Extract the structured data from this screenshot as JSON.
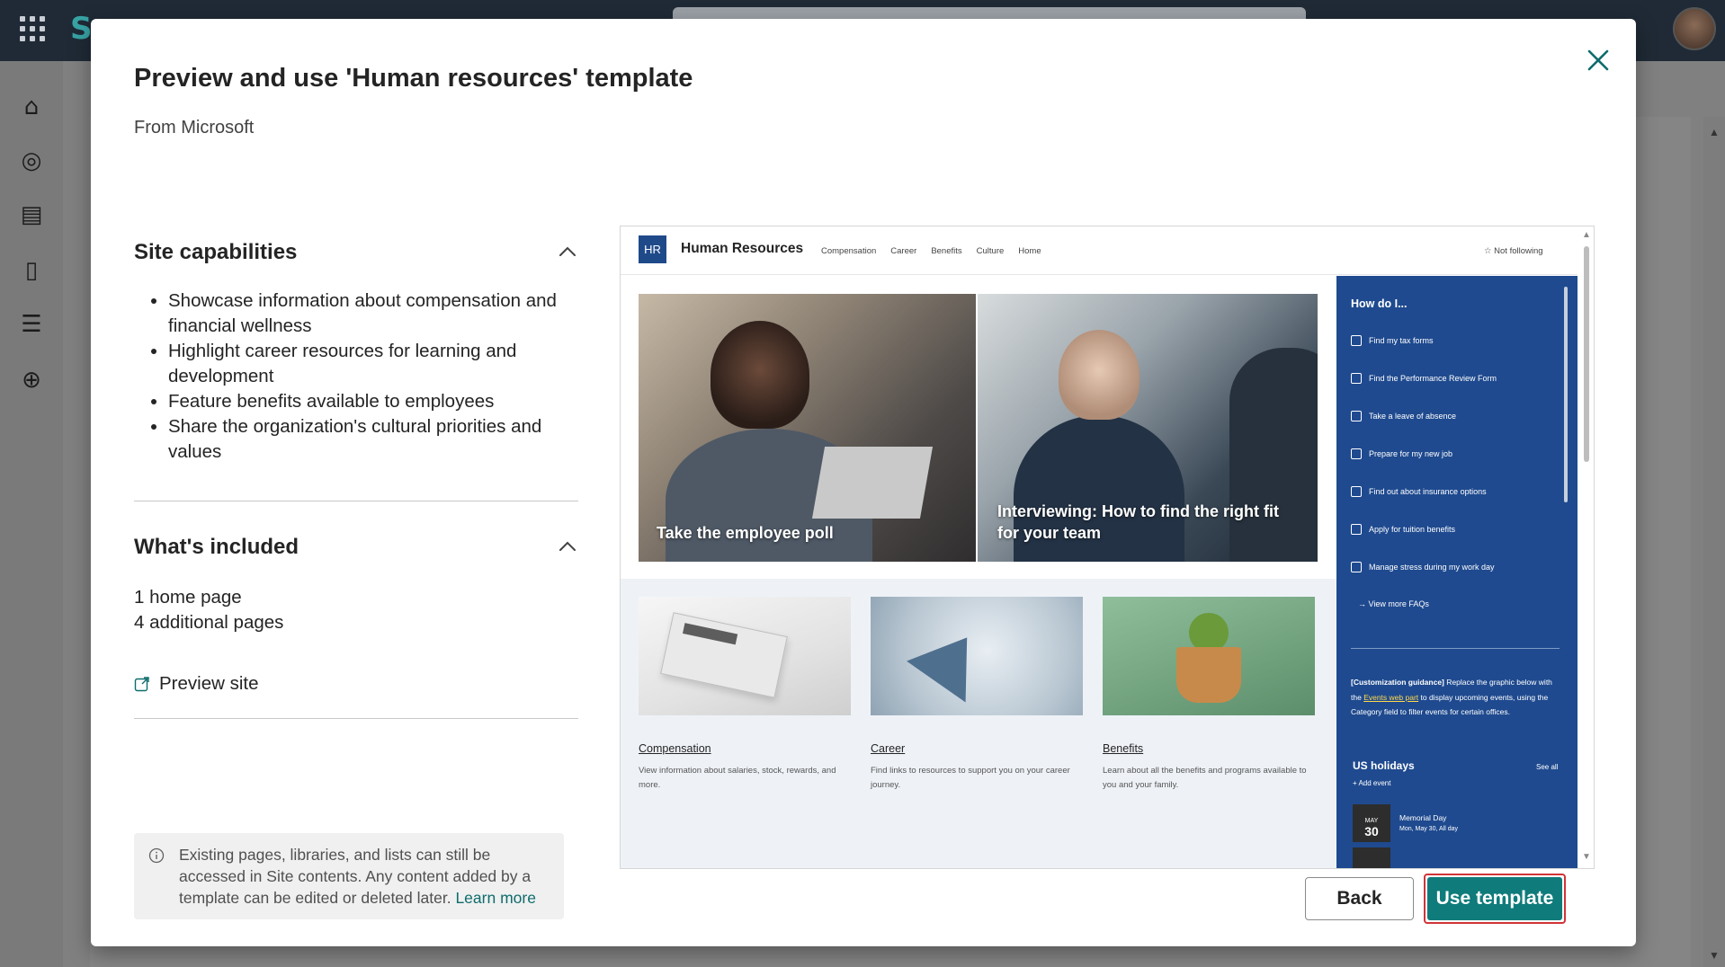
{
  "background": {
    "rail_icons": [
      "home-icon",
      "globe-icon",
      "news-icon",
      "document-icon",
      "list-icon",
      "add-circle-icon"
    ]
  },
  "dialog": {
    "title": "Preview and use 'Human resources' template",
    "subtitle": "From Microsoft",
    "capabilities": {
      "heading": "Site capabilities",
      "items": [
        "Showcase information about compensation and financial wellness",
        "Highlight career resources for learning and development",
        "Feature benefits available to employees",
        "Share the organization's cultural priorities and values"
      ]
    },
    "included": {
      "heading": "What's included",
      "lines": [
        "1 home page",
        "4 additional pages"
      ]
    },
    "preview_link": "Preview site",
    "info": {
      "text": "Existing pages, libraries, and lists can still be accessed in Site contents. Any content added by a template can be edited or deleted later.",
      "link": "Learn more"
    },
    "buttons": {
      "back": "Back",
      "use": "Use template"
    }
  },
  "preview": {
    "logo": "HR",
    "site_title": "Human Resources",
    "nav": [
      "Compensation",
      "Career",
      "Benefits",
      "Culture",
      "Home"
    ],
    "follow": "☆ Not following",
    "hero": [
      "Take the employee poll",
      "Interviewing: How to find the right fit for your team"
    ],
    "cards": [
      {
        "title": "Compensation",
        "desc": "View information about salaries, stock, rewards, and more."
      },
      {
        "title": "Career",
        "desc": "Find links to resources to support you on your career journey."
      },
      {
        "title": "Benefits",
        "desc": "Learn about all the benefits and programs available to you and your family."
      }
    ],
    "sidebar": {
      "heading": "How do I...",
      "items": [
        "Find my tax forms",
        "Find the Performance Review Form",
        "Take a leave of absence",
        "Prepare for my new job",
        "Find out about insurance options",
        "Apply for tuition benefits",
        "Manage stress during my work day"
      ],
      "more": "→ View more FAQs",
      "guidance_bold": "[Customization guidance]",
      "guidance_pre": " Replace the graphic below with the ",
      "guidance_link": "Events web part",
      "guidance_post": " to display upcoming events, using the Category field to filter events for certain offices.",
      "holidays": "US holidays",
      "see_all": "See all",
      "add_event": "+ Add event",
      "event": {
        "month": "MAY",
        "day": "30",
        "title": "Memorial Day",
        "date": "Mon, May 30, All day"
      }
    }
  }
}
